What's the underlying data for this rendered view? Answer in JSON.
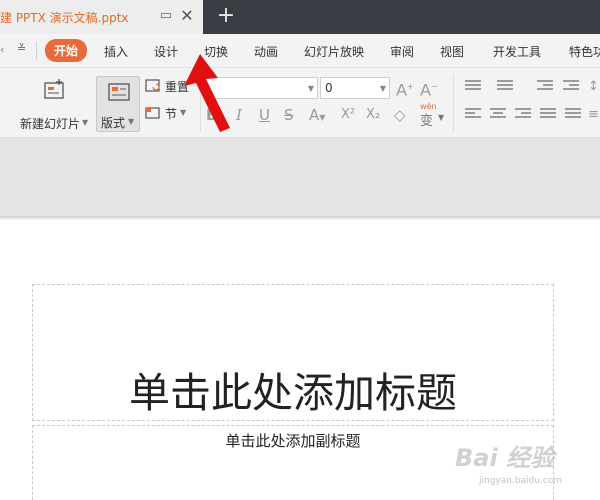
{
  "window": {
    "doc_title": "建 PPTX 演示文稿.pptx",
    "new_tab": "+"
  },
  "menu": {
    "left_arrow": "‹",
    "more": "≚",
    "items": [
      {
        "label": "开始",
        "active": true
      },
      {
        "label": "插入"
      },
      {
        "label": "设计"
      },
      {
        "label": "切换"
      },
      {
        "label": "动画"
      },
      {
        "label": "幻灯片放映"
      },
      {
        "label": "审阅"
      },
      {
        "label": "视图"
      },
      {
        "label": "开发工具"
      },
      {
        "label": "特色功"
      }
    ]
  },
  "ribbon": {
    "new_slide": "新建幻灯片",
    "layout": "版式",
    "reset": "重置",
    "section": "节",
    "font_name": "",
    "font_size": "0",
    "pinyin": "wén",
    "pinyin_char": "变"
  },
  "slide": {
    "title_placeholder": "单击此处添加标题",
    "subtitle_placeholder": "单击此处添加副标题"
  },
  "watermark": {
    "brand": "Bai 经验",
    "url": "jingyan.baidu.com"
  },
  "colors": {
    "accent": "#e8693a",
    "arrow": "#e01010",
    "titlebar": "#3a3c44"
  }
}
